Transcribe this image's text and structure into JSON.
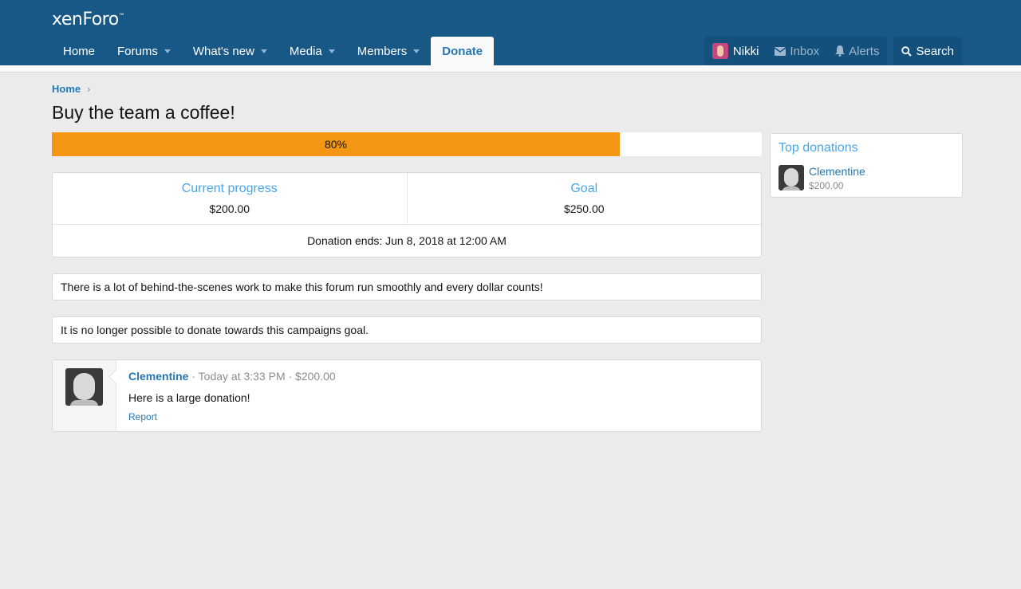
{
  "header": {
    "logo": "xenForo",
    "logo_tm": "™",
    "nav": [
      {
        "label": "Home"
      },
      {
        "label": "Forums"
      },
      {
        "label": "What's new"
      },
      {
        "label": "Media"
      },
      {
        "label": "Members"
      },
      {
        "label": "Donate"
      }
    ],
    "user_name": "Nikki",
    "inbox_label": "Inbox",
    "alerts_label": "Alerts",
    "search_label": "Search"
  },
  "breadcrumb": {
    "home": "Home"
  },
  "page": {
    "title": "Buy the team a coffee!"
  },
  "progress": {
    "label": "80%",
    "fraction": 0.8,
    "color": "#f39613"
  },
  "stats": {
    "current_label": "Current progress",
    "current_value": "$200.00",
    "goal_label": "Goal",
    "goal_value": "$250.00",
    "ends": "Donation ends: Jun 8, 2018 at 12:00 AM"
  },
  "notes": {
    "description": "There is a lot of behind-the-scenes work to make this forum run smoothly and every dollar counts!",
    "closed": "It is no longer possible to donate towards this campaigns goal."
  },
  "donation": {
    "user": "Clementine",
    "meta": " · Today at 3:33 PM · $200.00",
    "message": "Here is a large donation!",
    "report": "Report"
  },
  "sidebar": {
    "title": "Top donations",
    "items": [
      {
        "name": "Clementine",
        "amount": "$200.00"
      }
    ]
  },
  "colors": {
    "header": "#185886",
    "accent": "#2577b1",
    "highlight": "#47a7eb"
  }
}
